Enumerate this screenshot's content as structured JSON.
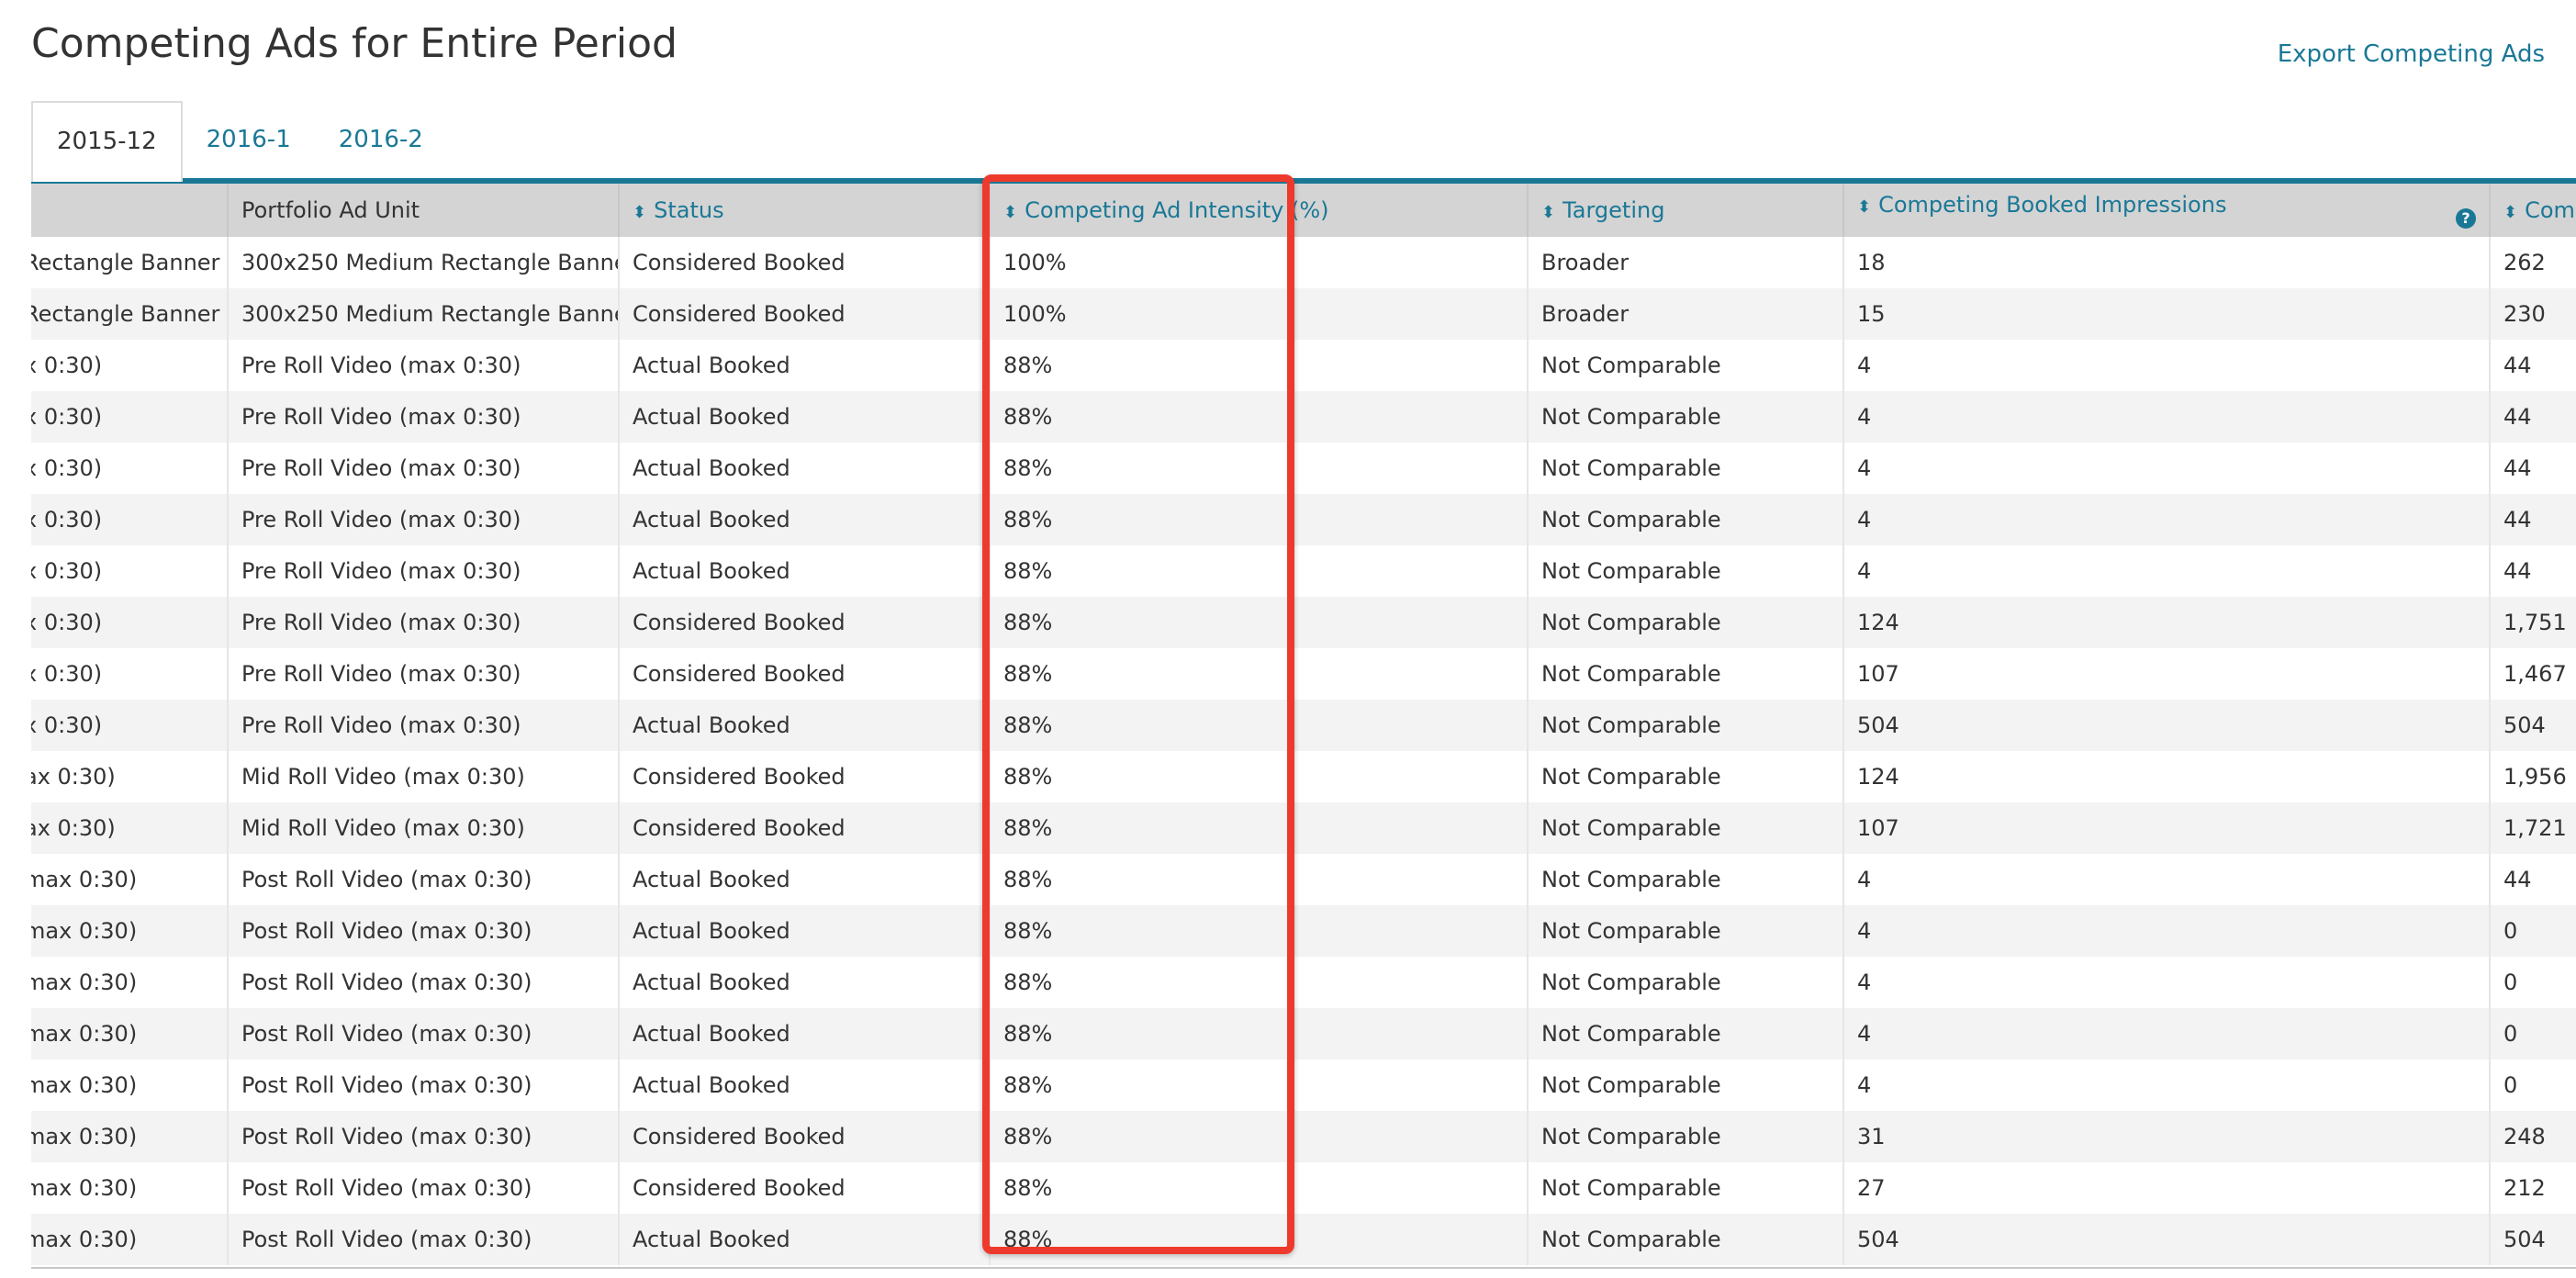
{
  "page": {
    "title": "Competing Ads for Entire Period",
    "export_label": "Export Competing Ads"
  },
  "tabs": [
    {
      "label": "2015-12",
      "active": true
    },
    {
      "label": "2016-1",
      "active": false
    },
    {
      "label": "2016-2",
      "active": false
    }
  ],
  "table": {
    "columns": [
      {
        "label": "",
        "sortable": false
      },
      {
        "label": "Portfolio Ad Unit",
        "sortable": false
      },
      {
        "label": "Status",
        "sortable": true
      },
      {
        "label": "Competing Ad Intensity (%)",
        "sortable": true
      },
      {
        "label": "Targeting",
        "sortable": true
      },
      {
        "label": "Competing Booked Impressions",
        "sortable": true,
        "help": "?"
      },
      {
        "label": "Com",
        "sortable": true
      }
    ],
    "rows": [
      [
        "Rectangle Banner",
        "300x250 Medium Rectangle Banner",
        "Considered Booked",
        "100%",
        "Broader",
        "18",
        "262"
      ],
      [
        "Rectangle Banner",
        "300x250 Medium Rectangle Banner",
        "Considered Booked",
        "100%",
        "Broader",
        "15",
        "230"
      ],
      [
        "x 0:30)",
        "Pre Roll Video (max 0:30)",
        "Actual Booked",
        "88%",
        "Not Comparable",
        "4",
        "44"
      ],
      [
        "x 0:30)",
        "Pre Roll Video (max 0:30)",
        "Actual Booked",
        "88%",
        "Not Comparable",
        "4",
        "44"
      ],
      [
        "x 0:30)",
        "Pre Roll Video (max 0:30)",
        "Actual Booked",
        "88%",
        "Not Comparable",
        "4",
        "44"
      ],
      [
        "x 0:30)",
        "Pre Roll Video (max 0:30)",
        "Actual Booked",
        "88%",
        "Not Comparable",
        "4",
        "44"
      ],
      [
        "x 0:30)",
        "Pre Roll Video (max 0:30)",
        "Actual Booked",
        "88%",
        "Not Comparable",
        "4",
        "44"
      ],
      [
        "x 0:30)",
        "Pre Roll Video (max 0:30)",
        "Considered Booked",
        "88%",
        "Not Comparable",
        "124",
        "1,751"
      ],
      [
        "x 0:30)",
        "Pre Roll Video (max 0:30)",
        "Considered Booked",
        "88%",
        "Not Comparable",
        "107",
        "1,467"
      ],
      [
        "x 0:30)",
        "Pre Roll Video (max 0:30)",
        "Actual Booked",
        "88%",
        "Not Comparable",
        "504",
        "504"
      ],
      [
        "ax 0:30)",
        "Mid Roll Video (max 0:30)",
        "Considered Booked",
        "88%",
        "Not Comparable",
        "124",
        "1,956"
      ],
      [
        "ax 0:30)",
        "Mid Roll Video (max 0:30)",
        "Considered Booked",
        "88%",
        "Not Comparable",
        "107",
        "1,721"
      ],
      [
        "max 0:30)",
        "Post Roll Video (max 0:30)",
        "Actual Booked",
        "88%",
        "Not Comparable",
        "4",
        "44"
      ],
      [
        "max 0:30)",
        "Post Roll Video (max 0:30)",
        "Actual Booked",
        "88%",
        "Not Comparable",
        "4",
        "0"
      ],
      [
        "max 0:30)",
        "Post Roll Video (max 0:30)",
        "Actual Booked",
        "88%",
        "Not Comparable",
        "4",
        "0"
      ],
      [
        "max 0:30)",
        "Post Roll Video (max 0:30)",
        "Actual Booked",
        "88%",
        "Not Comparable",
        "4",
        "0"
      ],
      [
        "max 0:30)",
        "Post Roll Video (max 0:30)",
        "Actual Booked",
        "88%",
        "Not Comparable",
        "4",
        "0"
      ],
      [
        "max 0:30)",
        "Post Roll Video (max 0:30)",
        "Considered Booked",
        "88%",
        "Not Comparable",
        "31",
        "248"
      ],
      [
        "max 0:30)",
        "Post Roll Video (max 0:30)",
        "Considered Booked",
        "88%",
        "Not Comparable",
        "27",
        "212"
      ],
      [
        "max 0:30)",
        "Post Roll Video (max 0:30)",
        "Actual Booked",
        "88%",
        "Not Comparable",
        "504",
        "504"
      ]
    ]
  },
  "colors": {
    "accent": "#1a7896",
    "highlight": "#ee3a2c",
    "header_bg": "#d4d4d4",
    "row_alt": "#f3f3f3"
  },
  "icons": {
    "sort": "sort-icon",
    "help": "help-icon"
  }
}
